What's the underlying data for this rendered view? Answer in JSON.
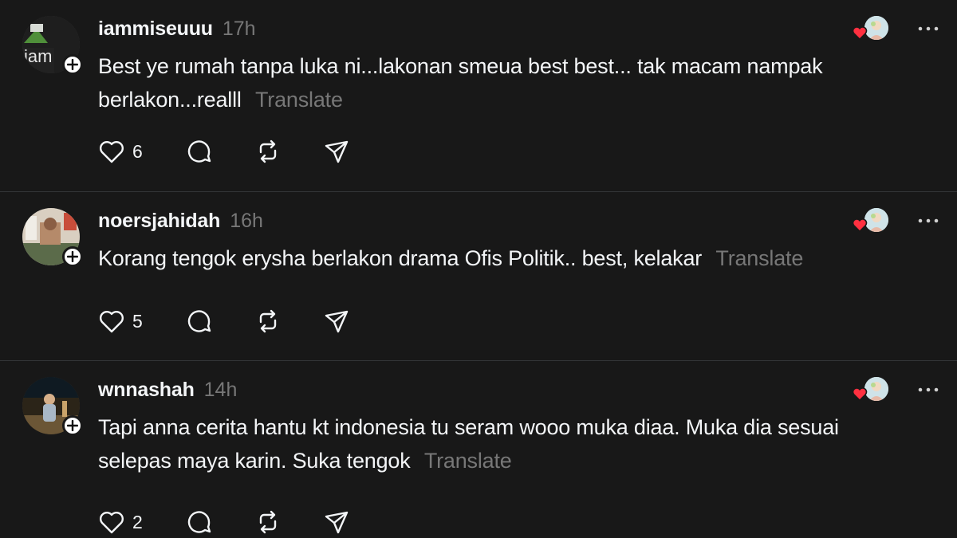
{
  "app": {
    "translate_label": "Translate",
    "icons": {
      "like": "heart-outline-icon",
      "reply": "speech-bubble-icon",
      "repost": "repost-arrows-icon",
      "share": "paper-plane-icon",
      "more": "more-dots-icon",
      "follow": "plus-icon",
      "liked_by_author": "red-heart-icon"
    },
    "colors": {
      "background": "#181818",
      "text_primary": "#f3f5f7",
      "text_secondary": "#777777",
      "divider": "#333638",
      "like_red": "#ff3040"
    }
  },
  "posts": [
    {
      "username": "iammiseuuu",
      "time": "17h",
      "text": "Best ye rumah tanpa luka ni...lakonan smeua best best... tak macam nampak berlakon...realll",
      "likes": "6"
    },
    {
      "username": "noersjahidah",
      "time": "16h",
      "text": "Korang tengok erysha berlakon drama Ofis Politik.. best, kelakar",
      "likes": "5"
    },
    {
      "username": "wnnashah",
      "time": "14h",
      "text": "Tapi anna cerita hantu kt indonesia tu seram wooo muka diaa. Muka dia sesuai selepas maya karin. Suka tengok",
      "likes": "2"
    }
  ]
}
